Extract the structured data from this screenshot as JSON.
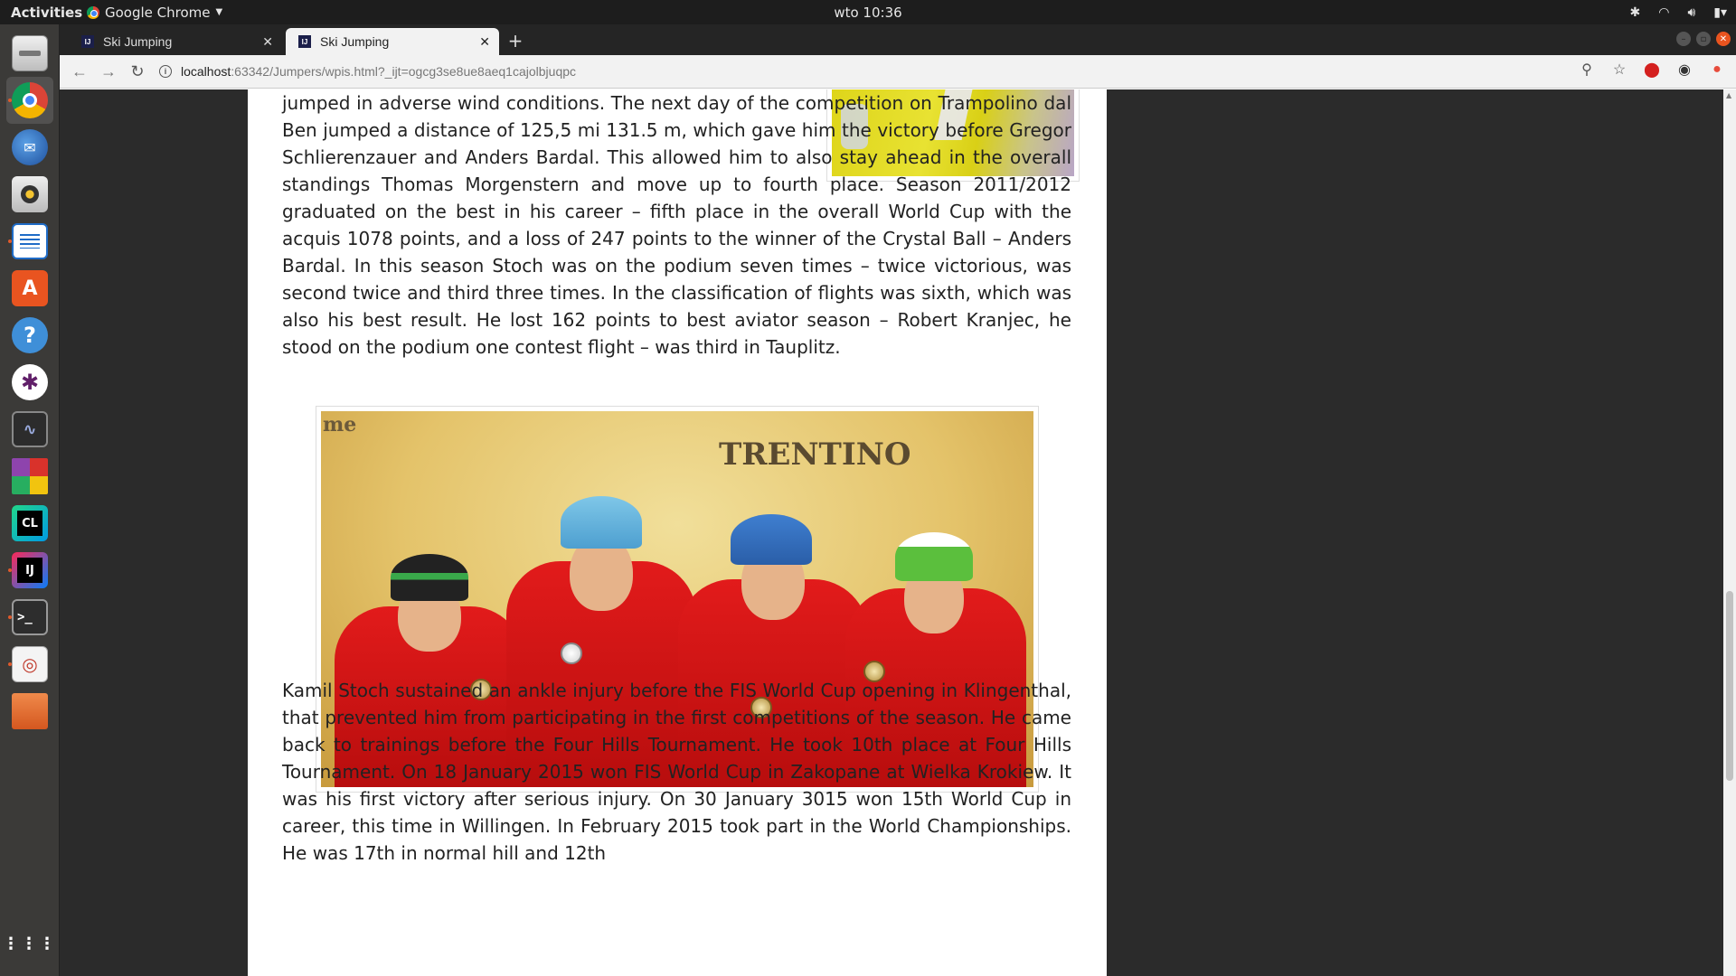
{
  "topbar": {
    "activities": "Activities",
    "app_name": "Google Chrome",
    "clock": "wto 10:36"
  },
  "dock": {
    "items": [
      {
        "name": "files",
        "icon": "cabinet-icon"
      },
      {
        "name": "google-chrome",
        "icon": "chrome-icon"
      },
      {
        "name": "thunderbird",
        "icon": "mail-icon"
      },
      {
        "name": "rhythmbox",
        "icon": "speaker-icon"
      },
      {
        "name": "libreoffice-writer",
        "icon": "writer-icon"
      },
      {
        "name": "software-center",
        "icon": "shopping-bag-icon"
      },
      {
        "name": "help",
        "icon": "help-icon"
      },
      {
        "name": "slack",
        "icon": "slack-icon"
      },
      {
        "name": "system-monitor",
        "icon": "monitor-icon"
      },
      {
        "name": "color-app",
        "icon": "color-blocks-icon"
      },
      {
        "name": "clion",
        "icon": "clion-icon",
        "label": "CL"
      },
      {
        "name": "intellij-idea",
        "icon": "intellij-icon",
        "label": "IJ"
      },
      {
        "name": "terminal",
        "icon": "terminal-icon",
        "label": ">_"
      },
      {
        "name": "screen-recorder",
        "icon": "recorder-icon"
      },
      {
        "name": "folder",
        "icon": "folder-icon"
      },
      {
        "name": "show-applications",
        "icon": "apps-grid-icon"
      }
    ]
  },
  "browser": {
    "tabs": [
      {
        "title": "Ski Jumping",
        "favicon": "IJ",
        "active": false
      },
      {
        "title": "Ski Jumping",
        "favicon": "IJ",
        "active": true
      }
    ],
    "url_host": "localhost",
    "url_rest": ":63342/Jumpers/wpis.html?_ijt=ogcg3se8ue8aeq1cajolbjuqpc"
  },
  "article": {
    "paragraph1": "jumped in adverse wind conditions. The next day of the competition on Trampolino dal Ben jumped a distance of 125,5 mi 131.5 m, which gave him the victory before Gregor Schlierenzauer and Anders Bardal. This allowed him to also stay ahead in the overall standings Thomas Morgenstern and move up to fourth place. Season 2011/2012 graduated on the best in his career – fifth place in the overall World Cup with the acquis 1078 points, and a loss of 247 points to the winner of the Crystal Ball – Anders Bardal. In this season Stoch was on the podium seven times – twice victorious, was second twice and third three times. In the classification of flights was sixth, which was also his best result. He lost 162 points to best aviator season – Robert Kranjec, he stood on the podium one contest flight – was third in Tauplitz.",
    "paragraph2": "Kamil Stoch sustained an ankle injury before the FIS World Cup opening in Klingenthal, that prevented him from participating in the first competitions of the season. He came back to trainings before the Four Hills Tournament. He took 10th place at Four Hills Tournament. On 18 January 2015 won FIS World Cup in Zakopane at Wielka Krokiew. It was his first victory after serious injury. On 30 January 3015 won 15th World Cup in career, this time in Willingen. In February 2015 took part in the World Championships. He was 17th in normal hill and 12th",
    "photo_sign_main": "TRENTINO",
    "photo_sign_left": "me"
  }
}
